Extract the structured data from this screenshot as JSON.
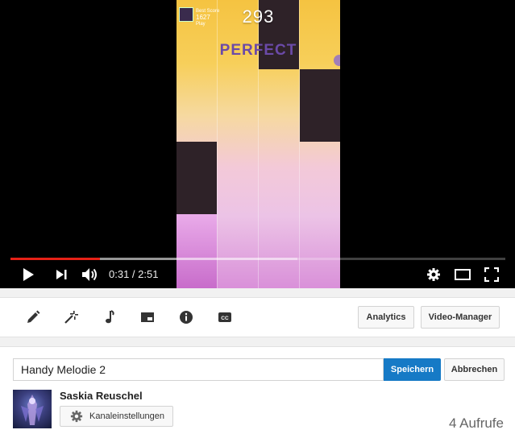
{
  "player": {
    "game": {
      "best_label": "Best Score",
      "best_score": "1627",
      "best_sub": "Play",
      "score": "293",
      "feedback": "PERFECT"
    },
    "time_display": "0:31 / 2:51",
    "progress_played_fraction": 0.18,
    "progress_loaded_fraction": 0.58,
    "colors": {
      "progress": "#e62117"
    }
  },
  "toolbar": {
    "tools": [
      "edit-icon",
      "magic-wand-icon",
      "music-note-icon",
      "end-screen-icon",
      "info-icon",
      "cc-icon"
    ],
    "analytics_label": "Analytics",
    "video_manager_label": "Video-Manager"
  },
  "info": {
    "title_value": "Handy Melodie 2",
    "save_label": "Speichern",
    "cancel_label": "Abbrechen",
    "channel_name": "Saskia Reuschel",
    "channel_settings_label": "Kanaleinstellungen",
    "views": "4 Aufrufe",
    "colors": {
      "save_button": "#167ac6"
    }
  }
}
